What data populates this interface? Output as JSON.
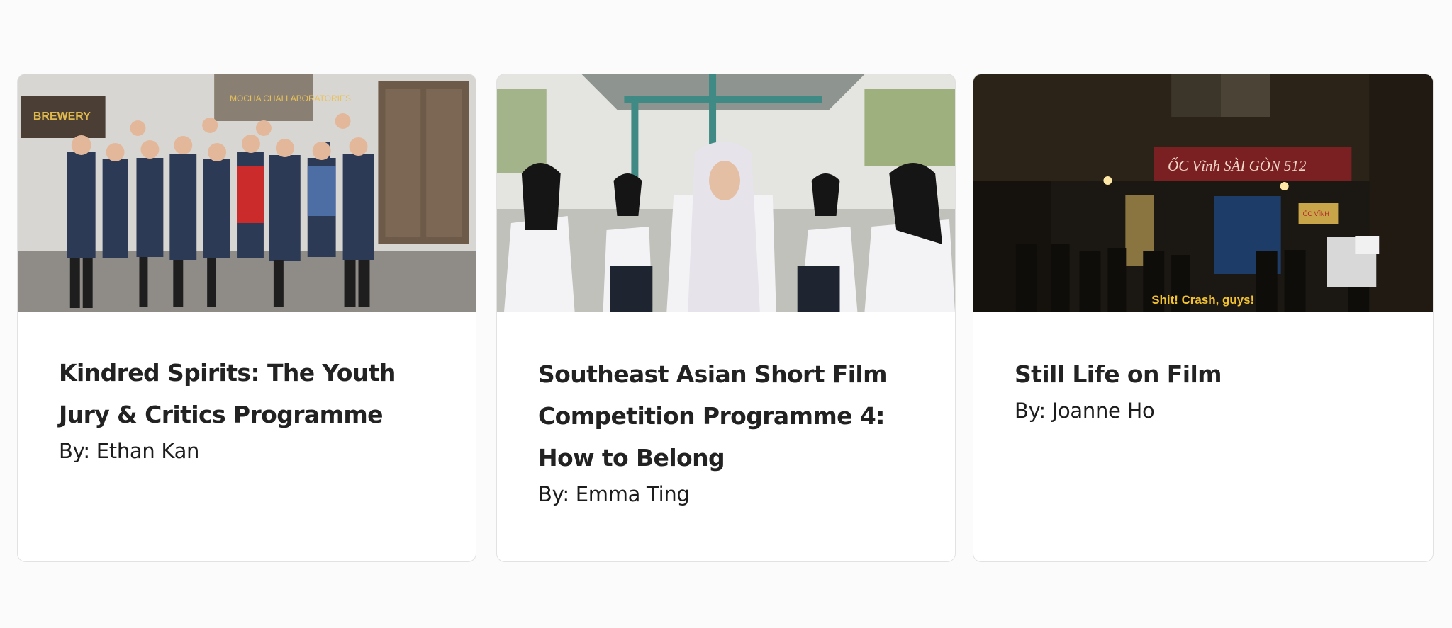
{
  "cards": [
    {
      "title": "Kindred Spirits: The Youth Jury & Critics Programme",
      "author": "By: Ethan Kan",
      "image_signs": [
        "BREWERY",
        "MOCHA CHAI LABORATORIES"
      ]
    },
    {
      "title": "Southeast Asian Short Film Competition Programme 4: How to Belong",
      "author": "By: Emma Ting"
    },
    {
      "title": "Still Life on Film",
      "author": "By: Joanne Ho",
      "image_signs": [
        "ỐC Vĩnh SÀI GÒN 512",
        "ỐC VĨNH"
      ],
      "image_subtitle": "Shit! Crash, guys!"
    }
  ],
  "colors": {
    "page_background": "#fbfbfb",
    "card_background": "#ffffff",
    "card_border": "#e2e2e2",
    "title_text": "#222222",
    "author_text": "#1c1c1c",
    "subtitle_yellow": "#f2c230"
  }
}
